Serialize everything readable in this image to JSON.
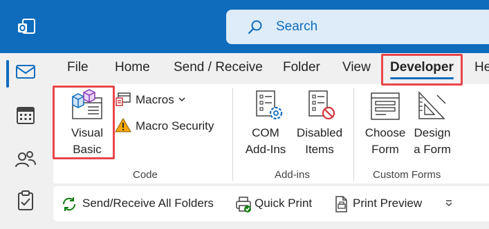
{
  "search": {
    "placeholder": "Search"
  },
  "menu": {
    "tabs": [
      {
        "label": "File"
      },
      {
        "label": "Home"
      },
      {
        "label": "Send / Receive"
      },
      {
        "label": "Folder"
      },
      {
        "label": "View"
      },
      {
        "label": "Developer",
        "active": true
      },
      {
        "label": "He"
      }
    ]
  },
  "ribbon": {
    "groups": [
      {
        "label": "Code",
        "items": [
          {
            "label_line1": "Visual",
            "label_line2": "Basic",
            "icon": "visual-basic-icon"
          },
          {
            "label": "Macros",
            "icon": "macros-icon",
            "dropdown": true
          },
          {
            "label": "Macro Security",
            "icon": "warning-icon"
          }
        ]
      },
      {
        "label": "Add-ins",
        "items": [
          {
            "label_line1": "COM",
            "label_line2": "Add-Ins",
            "icon": "com-addins-icon"
          },
          {
            "label_line1": "Disabled",
            "label_line2": "Items",
            "icon": "disabled-items-icon"
          }
        ]
      },
      {
        "label": "Custom Forms",
        "items": [
          {
            "label_line1": "Choose",
            "label_line2": "Form",
            "icon": "choose-form-icon"
          },
          {
            "label_line1": "Design",
            "label_line2": "a Form",
            "icon": "design-form-icon"
          }
        ]
      }
    ]
  },
  "quick_access": {
    "items": [
      {
        "label": "Send/Receive All Folders",
        "icon": "sync-icon"
      },
      {
        "label": "Quick Print",
        "icon": "printer-icon"
      },
      {
        "label": "Print Preview",
        "icon": "print-preview-icon"
      }
    ],
    "overflow_icon": "chevron-down-icon"
  },
  "colors": {
    "accent": "#0f6cbd",
    "highlight": "#e8464a",
    "warning": "#f7a700"
  }
}
